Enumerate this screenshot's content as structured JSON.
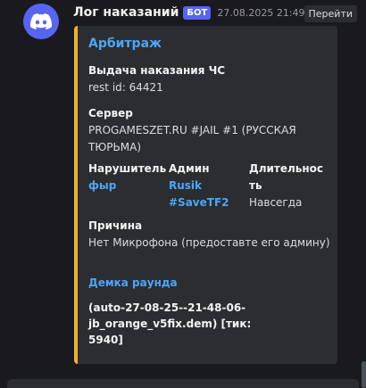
{
  "message": {
    "avatar_icon": "discord-logo-icon",
    "username": "Лог наказаний",
    "bot_badge": "БОТ",
    "timestamp": "27.08.2025 21:49",
    "jump_label": "Перейти"
  },
  "embed": {
    "accent_color": "#f0b232",
    "title": "Арбитраж",
    "fields": {
      "punishment_name": "Выдача наказания ЧС",
      "rest_id": "rest id: 64421",
      "server_name": "Сервер",
      "server_value_line1": "PROGAMESZET.RU #JAIL #1 (РУССКАЯ",
      "server_value_line2": "ТЮРЬМА)",
      "violator_name": "Нарушитель",
      "violator_value": "фыр",
      "admin_name": "Админ",
      "admin_value_line1": "Rusik",
      "admin_value_line2": "#SaveTF2",
      "duration_name_line1": "Длительнос",
      "duration_name_line2": "ть",
      "duration_value": "Навсегда",
      "reason_name": "Причина",
      "reason_value": "Нет Микрофона (предоставте его админу)"
    },
    "demo_title": "Демка раунда",
    "demo_line1": "(auto-27-08-25--21-48-06-",
    "demo_line2": "jb_orange_v5fix.dem) [тик: 5940]"
  },
  "colors": {
    "link": "#4fa5f5",
    "brand": "#5865f2",
    "background": "#1a1a1e",
    "embed_background": "#2b2d31"
  }
}
